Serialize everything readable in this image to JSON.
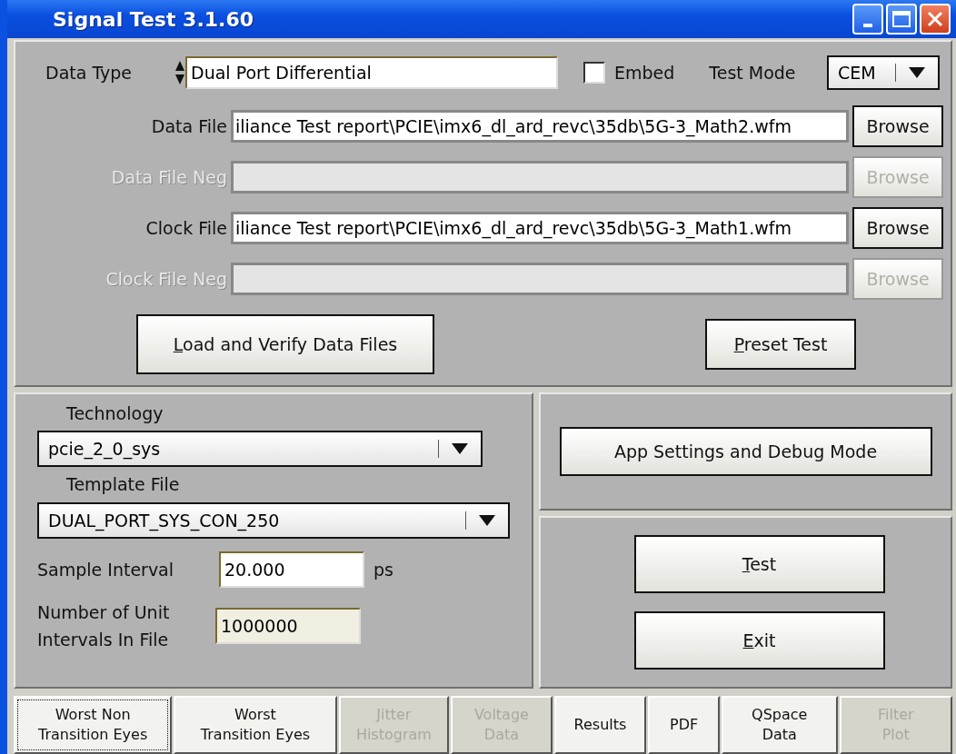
{
  "window": {
    "title": "Signal Test 3.1.60"
  },
  "data_type": {
    "label": "Data Type",
    "value": "Dual Port Differential"
  },
  "embed": {
    "label": "Embed",
    "checked": false
  },
  "test_mode": {
    "label": "Test Mode",
    "value": "CEM"
  },
  "file_rows": [
    {
      "label": "Data File",
      "value": "iliance Test report\\PCIE\\imx6_dl_ard_revc\\35db\\5G-3_Math2.wfm",
      "button": "Browse",
      "disabled": false
    },
    {
      "label": "Data File Neg",
      "button": "Browse",
      "disabled": true
    },
    {
      "label": "Clock File",
      "value": "iliance Test report\\PCIE\\imx6_dl_ard_revc\\35db\\5G-3_Math1.wfm",
      "button": "Browse",
      "disabled": false
    },
    {
      "label": "Clock File Neg",
      "button": "Browse",
      "disabled": true
    }
  ],
  "load_button": "Load and Verify Data Files",
  "preset_button": "Preset Test",
  "technology": {
    "label": "Technology",
    "value": "pcie_2_0_sys"
  },
  "template": {
    "label": "Template File",
    "value": "DUAL_PORT_SYS_CON_250"
  },
  "sample_interval": {
    "label": "Sample Interval",
    "value": "20.000",
    "unit": "ps"
  },
  "unit_intervals": {
    "label": "Number of Unit\nIntervals In File",
    "value": "1000000"
  },
  "app_settings_button": "App Settings and Debug Mode",
  "test_button": "Test",
  "exit_button": "Exit",
  "tabs": [
    {
      "label": "Worst Non\nTransition Eyes",
      "selected": true,
      "disabled": false
    },
    {
      "label": "Worst\nTransition Eyes",
      "selected": false,
      "disabled": false
    },
    {
      "label": "Jitter\nHistogram",
      "selected": false,
      "disabled": true
    },
    {
      "label": "Voltage\nData",
      "selected": false,
      "disabled": true
    },
    {
      "label": "Results",
      "selected": false,
      "disabled": false
    },
    {
      "label": "PDF",
      "selected": false,
      "disabled": false
    },
    {
      "label": "QSpace\nData",
      "selected": false,
      "disabled": false
    },
    {
      "label": "Filter\nPlot",
      "selected": false,
      "disabled": true
    }
  ]
}
